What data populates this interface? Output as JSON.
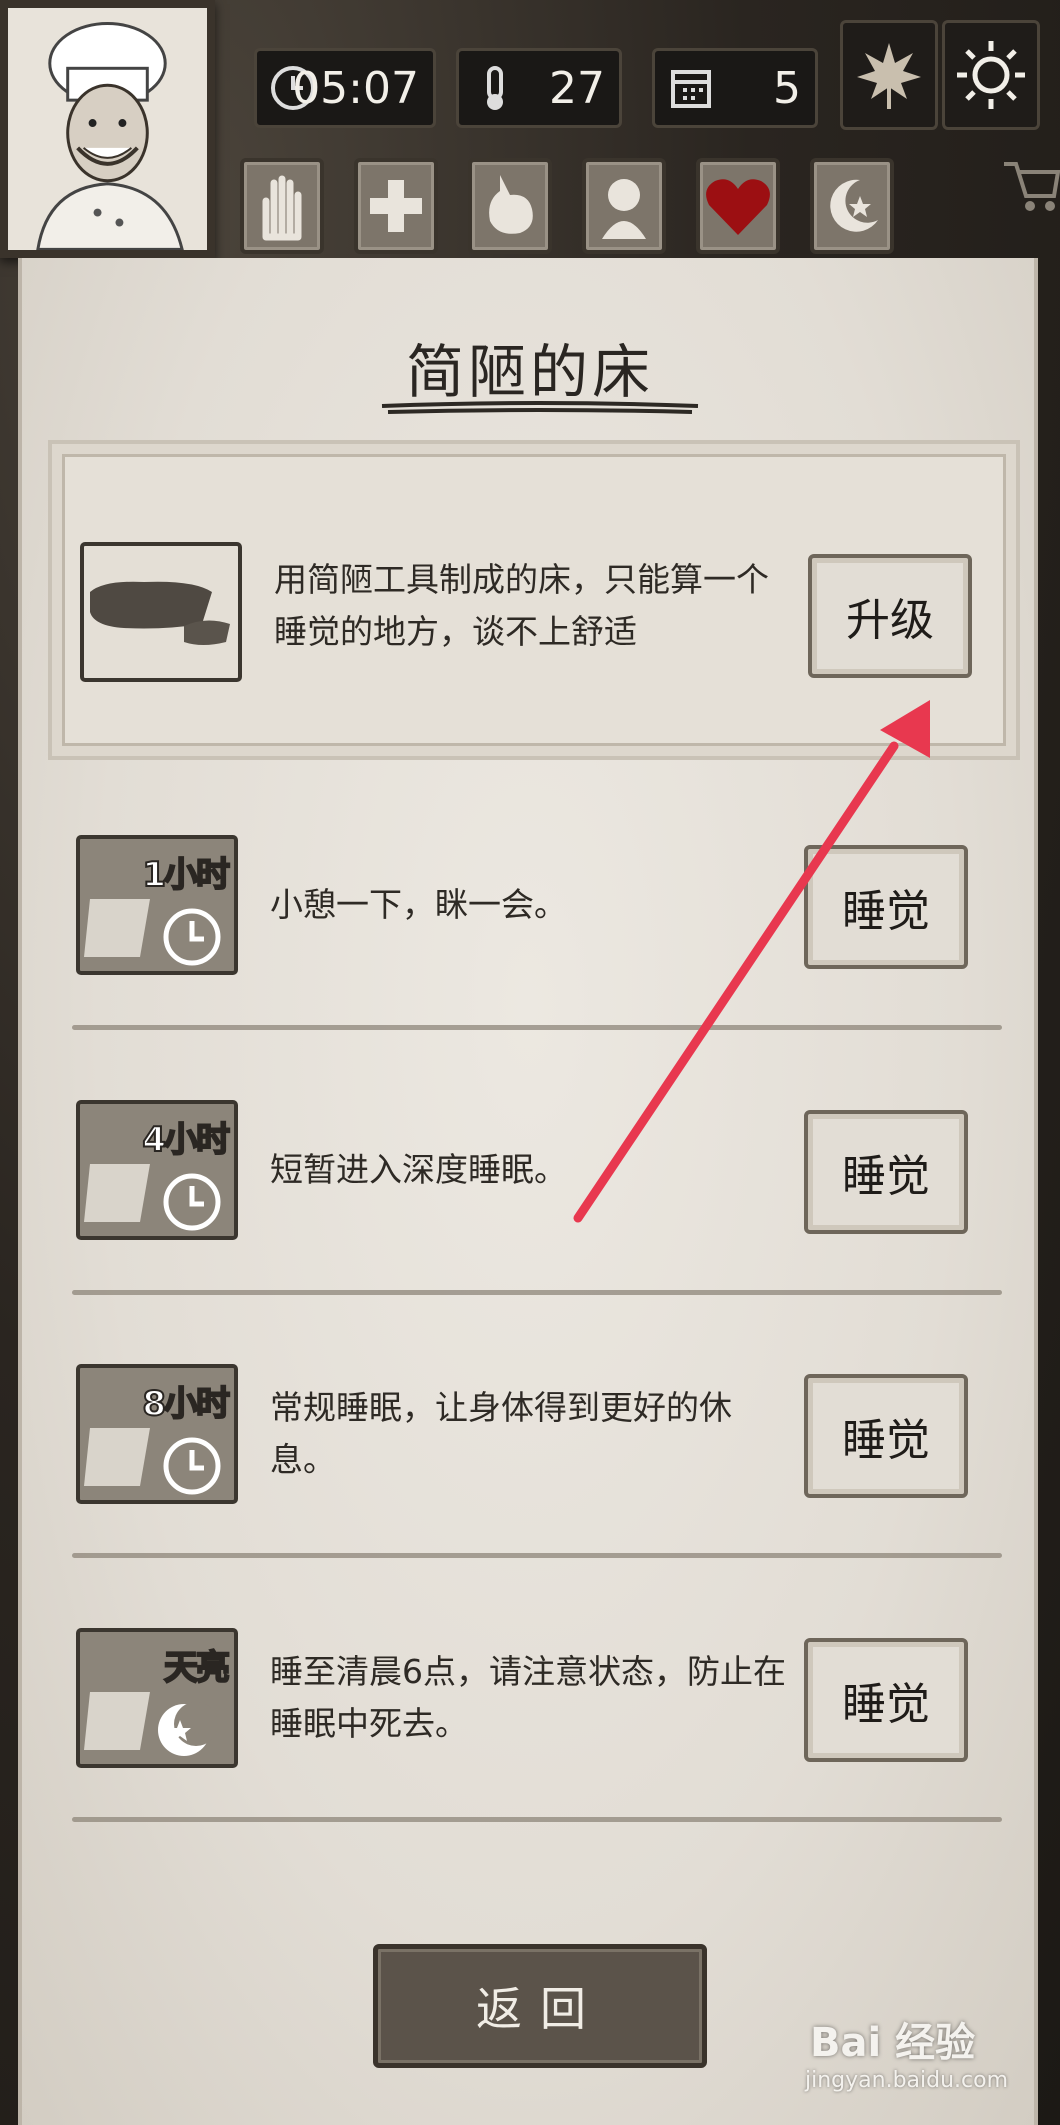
{
  "hud": {
    "time": "05:07",
    "temperature": "27",
    "day": "5",
    "season_icon": "leaf-icon",
    "weather_icon": "sun-icon",
    "status_icons": [
      "hand-icon",
      "health-cross-icon",
      "stomach-icon",
      "head-icon",
      "heart-icon",
      "moon-icon"
    ]
  },
  "panel": {
    "title": "简陋的床",
    "bed": {
      "description": "用简陋工具制成的床，只能算一个睡觉的地方，谈不上舒适",
      "button": "升级"
    },
    "sleep_options": [
      {
        "label": "1小时",
        "description": "小憩一下，眯一会。",
        "button": "睡觉"
      },
      {
        "label": "4小时",
        "description": "短暂进入深度睡眠。",
        "button": "睡觉"
      },
      {
        "label": "8小时",
        "description": "常规睡眠，让身体得到更好的休息。",
        "button": "睡觉"
      },
      {
        "label": "天亮",
        "description": "睡至清晨6点，请注意状态，防止在睡眠中死去。",
        "button": "睡觉"
      }
    ],
    "return_button": "返回"
  },
  "watermark": {
    "brand": "Bai 经验",
    "url": "jingyan.baidu.com"
  },
  "colors": {
    "arrow": "#e8384f",
    "parchment": "#e6e1d9",
    "heart": "#9c0f12"
  }
}
